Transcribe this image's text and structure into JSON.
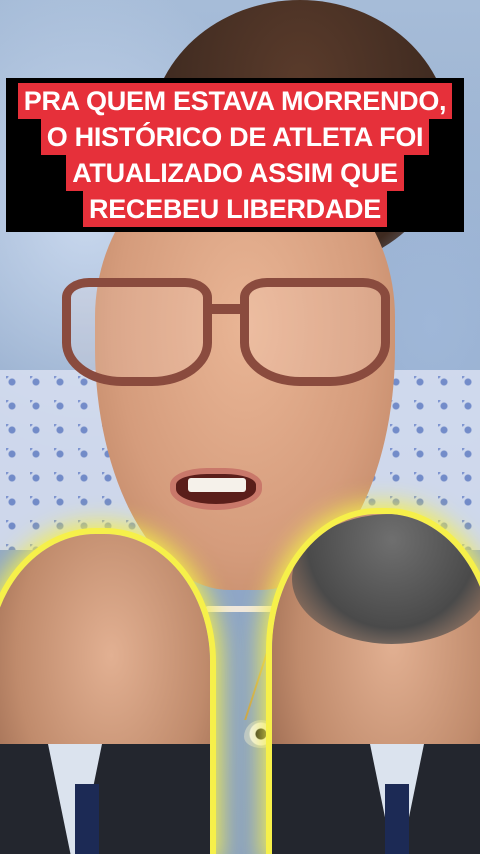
{
  "caption": {
    "lines": [
      "PRA QUEM ESTAVA MORRENDO,",
      "O HISTÓRICO DE ATLETA FOI",
      "ATUALIZADO ASSIM QUE",
      "RECEBEU LIBERDADE"
    ],
    "background_color": "#e6303a",
    "text_color": "#ffffff",
    "box_color": "#000000"
  },
  "overlay": {
    "glow_color": "#f6f04a"
  }
}
